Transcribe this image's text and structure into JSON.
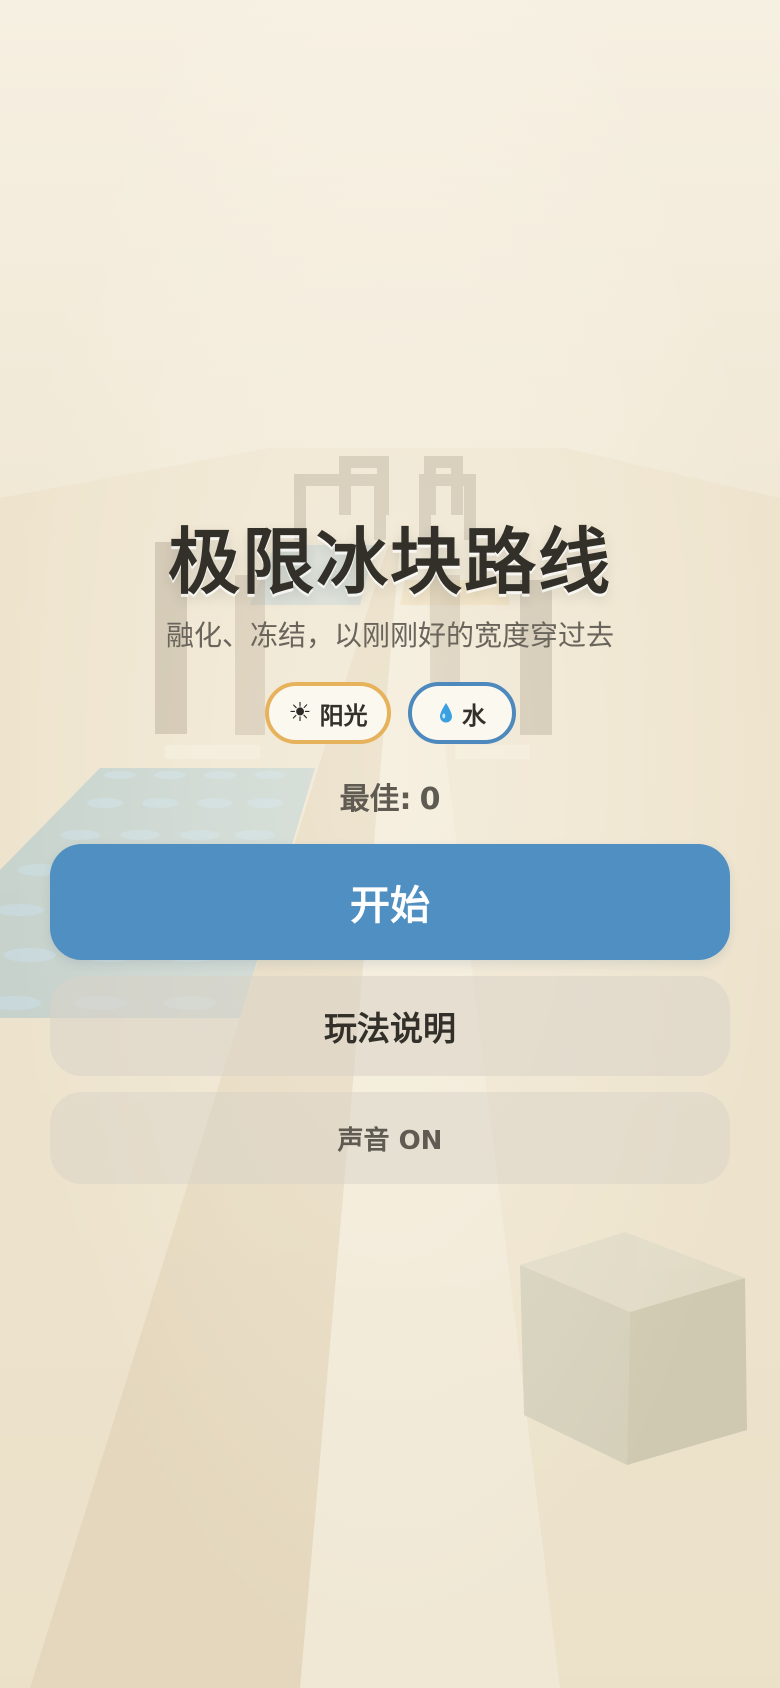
{
  "game": {
    "title": "极限冰块路线",
    "subtitle": "融化、冻结，以刚刚好的宽度穿过去"
  },
  "legend": {
    "sun_icon": "sun-icon",
    "sun_label": "阳光",
    "water_icon": "water-drop-icon",
    "water_label": "水"
  },
  "score": {
    "best_label": "最佳:",
    "best_value": "0"
  },
  "buttons": {
    "start_label": "开始",
    "howto_label": "玩法说明",
    "sound_label": "声音 ON"
  },
  "colors": {
    "primary": "#4f8fc1",
    "sun_accent": "#e6b25c",
    "water_accent": "#4d89bd",
    "title_text": "#33302a"
  }
}
